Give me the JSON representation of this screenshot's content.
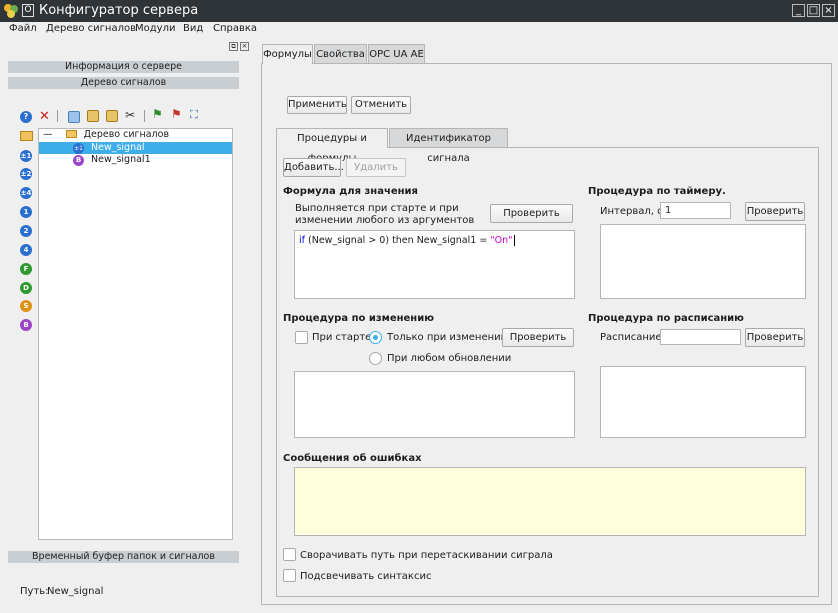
{
  "window": {
    "title": "Конфигуратор сервера",
    "pin_label": "O"
  },
  "menu": [
    "Файл",
    "Дерево сигналов",
    "Модули",
    "Вид",
    "Справка"
  ],
  "left": {
    "server_info": "Информация о сервере",
    "signal_tree_header": "Дерево сигналов",
    "tree": {
      "root": "Дерево сигналов",
      "items": [
        "New_signal",
        "New_signal1"
      ]
    },
    "buffer": "Временный буфер папок и сигналов",
    "path_label": "Путь:",
    "path_value": "New_signal",
    "side_icons": [
      {
        "text": "?",
        "color": "#2a6fd0"
      },
      {
        "text": "",
        "color": "#3a8e3a"
      },
      {
        "text": "±1",
        "color": "#2a6fd0"
      },
      {
        "text": "±2",
        "color": "#2a6fd0"
      },
      {
        "text": "±4",
        "color": "#2a6fd0"
      },
      {
        "text": "1",
        "color": "#2a6fd0"
      },
      {
        "text": "2",
        "color": "#2a6fd0"
      },
      {
        "text": "4",
        "color": "#2a6fd0"
      },
      {
        "text": "F",
        "color": "#2f9a2f"
      },
      {
        "text": "D",
        "color": "#2f9a2f"
      },
      {
        "text": "S",
        "color": "#e08f17"
      },
      {
        "text": "B",
        "color": "#9b45c9"
      }
    ]
  },
  "tabs": [
    "Формулы",
    "Свойства",
    "OPC UA AE"
  ],
  "actions": {
    "apply": "Применить",
    "cancel": "Отменить"
  },
  "subtabs": [
    "Процедуры и формулы",
    "Идентификатор сигнала"
  ],
  "buttons": {
    "add": "Добавить...",
    "remove": "Удалить",
    "check": "Проверить"
  },
  "formula": {
    "title": "Формула для значения",
    "desc": "Выполняется при старте и при изменении любого из аргументов",
    "code_kw": "if",
    "code_mid": "(New_signal > 0) then New_signal1 = ",
    "code_str": "\"On\""
  },
  "timer": {
    "title": "Процедура по таймеру.",
    "interval_label": "Интервал, с:",
    "interval_value": "1"
  },
  "change": {
    "title": "Процедура по изменению",
    "on_start": "При старте",
    "only_change": "Только при изменении",
    "any_update": "При любом обновлении"
  },
  "schedule": {
    "title": "Процедура по расписанию",
    "label": "Расписание:",
    "value": ""
  },
  "errors": {
    "title": "Сообщения об ошибках"
  },
  "options": {
    "collapse": "Сворачивать путь при перетаскивании сиграла",
    "highlight": "Подсвечивать синтаксис"
  },
  "colors": {
    "selection": "#3daee9",
    "error_bg": "#ffffdd",
    "keyword": "#0000cc",
    "string": "#cc00cc"
  }
}
